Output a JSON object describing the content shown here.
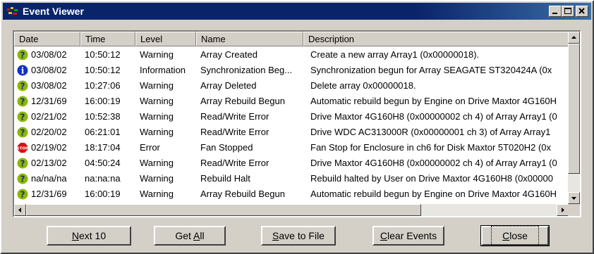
{
  "window": {
    "title": "Event Viewer"
  },
  "columns": [
    "Date",
    "Time",
    "Level",
    "Name",
    "Description"
  ],
  "events": [
    {
      "icon": "warning-icon",
      "date": "03/08/02",
      "time": "10:50:12",
      "level": "Warning",
      "name": "Array Created",
      "description": "Create a new array Array1 (0x00000018)."
    },
    {
      "icon": "information-icon",
      "date": "03/08/02",
      "time": "10:50:12",
      "level": "Information",
      "name": "Synchronization Beg...",
      "description": "Synchronization begun for Array SEAGATE ST320424A (0x"
    },
    {
      "icon": "warning-icon",
      "date": "03/08/02",
      "time": "10:27:06",
      "level": "Warning",
      "name": "Array Deleted",
      "description": "Delete array 0x00000018."
    },
    {
      "icon": "warning-icon",
      "date": "12/31/69",
      "time": "16:00:19",
      "level": "Warning",
      "name": "Array Rebuild Begun",
      "description": "Automatic rebuild begun by Engine on Drive Maxtor 4G160H"
    },
    {
      "icon": "warning-icon",
      "date": "02/21/02",
      "time": "10:52:38",
      "level": "Warning",
      "name": "Read/Write Error",
      "description": "Drive Maxtor 4G160H8 (0x00000002 ch 4) of Array Array1 (0"
    },
    {
      "icon": "warning-icon",
      "date": "02/20/02",
      "time": "06:21:01",
      "level": "Warning",
      "name": "Read/Write Error",
      "description": "Drive WDC AC313000R (0x00000001 ch 3) of Array Array1"
    },
    {
      "icon": "stop-icon",
      "date": "02/19/02",
      "time": "18:17:04",
      "level": "Error",
      "name": "Fan Stopped",
      "description": "Fan Stop for Enclosure in ch6 for Disk Maxtor 5T020H2 (0x"
    },
    {
      "icon": "warning-icon",
      "date": "02/13/02",
      "time": "04:50:24",
      "level": "Warning",
      "name": "Read/Write Error",
      "description": "Drive Maxtor 4G160H8 (0x00000002 ch 4) of Array Array1 (0"
    },
    {
      "icon": "warning-icon",
      "date": "na/na/na",
      "time": "na:na:na",
      "level": "Warning",
      "name": "Rebuild Halt",
      "description": "Rebuild halted by User on Drive Maxtor 4G160H8 (0x00000"
    },
    {
      "icon": "warning-icon",
      "date": "12/31/69",
      "time": "16:00:19",
      "level": "Warning",
      "name": "Array Rebuild Begun",
      "description": "Automatic rebuild begun by Engine on Drive Maxtor 4G160H"
    }
  ],
  "buttons": {
    "next": {
      "mnemonic": "N",
      "rest": "ext 10"
    },
    "get_all": {
      "pre": "Get ",
      "mnemonic": "A",
      "rest": "ll"
    },
    "save": {
      "mnemonic": "S",
      "rest": "ave to File"
    },
    "clear": {
      "mnemonic": "C",
      "rest": "lear Events"
    },
    "close": {
      "mnemonic": "C",
      "rest": "lose"
    }
  },
  "colors": {
    "title_bar": "#0a246a",
    "window_face": "#d4d0c8",
    "warning": "#8cb800",
    "information": "#1030c8",
    "error": "#d81010"
  }
}
